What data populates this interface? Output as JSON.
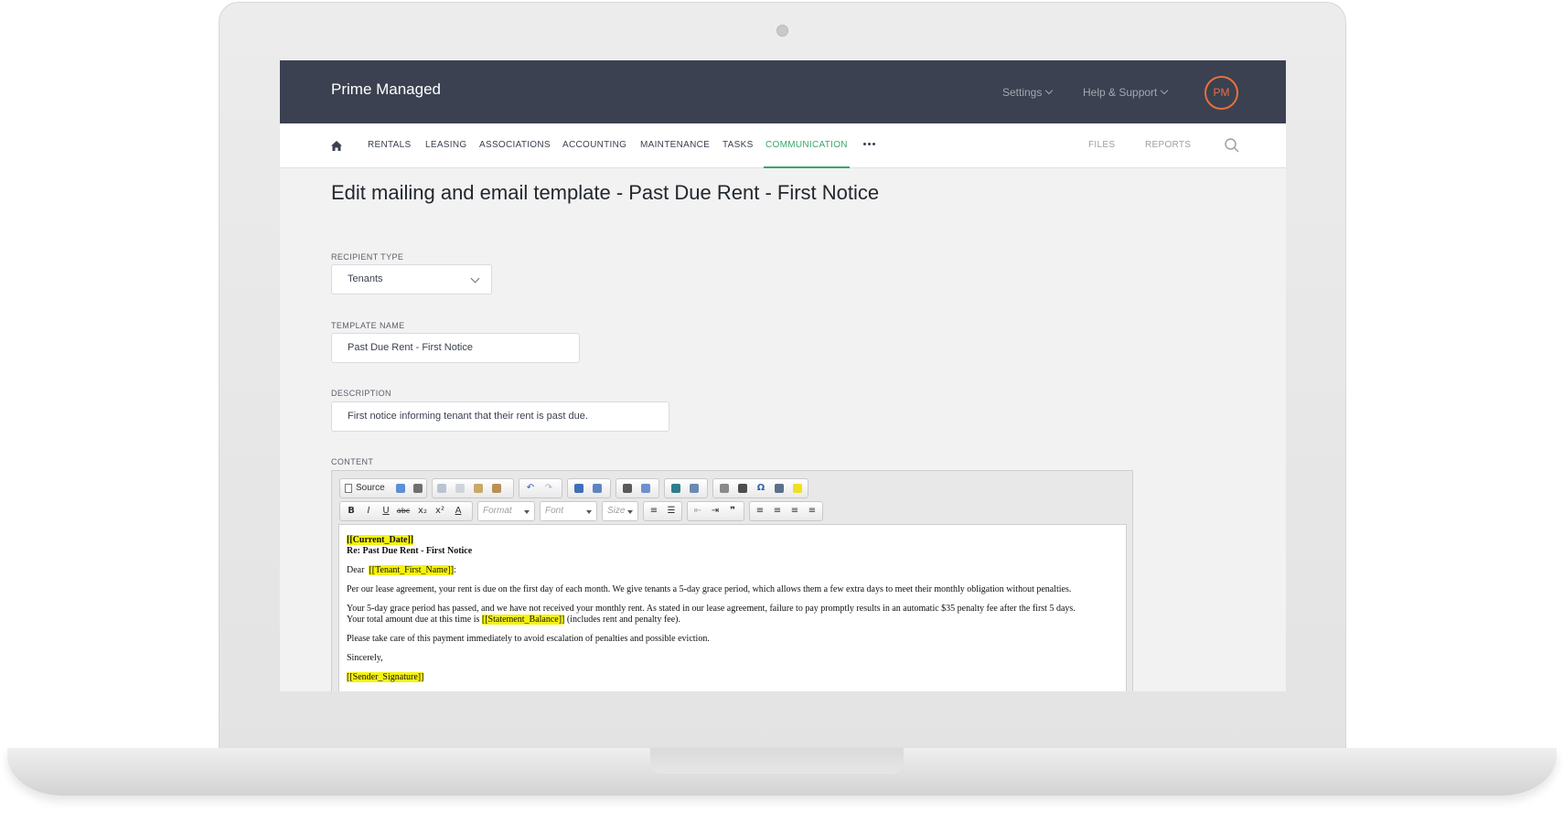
{
  "app": {
    "brand": "Prime Managed",
    "top_menu": {
      "settings": "Settings",
      "help": "Help & Support",
      "avatar_initials": "PM"
    }
  },
  "nav": {
    "items": [
      "RENTALS",
      "LEASING",
      "ASSOCIATIONS",
      "ACCOUNTING",
      "MAINTENANCE",
      "TASKS",
      "COMMUNICATION"
    ],
    "active": "COMMUNICATION",
    "right_items": [
      "FILES",
      "REPORTS"
    ]
  },
  "page": {
    "title": "Edit mailing and email template - Past Due Rent - First Notice"
  },
  "form": {
    "recipient_type": {
      "label": "RECIPIENT TYPE",
      "value": "Tenants"
    },
    "template_name": {
      "label": "TEMPLATE NAME",
      "value": "Past Due Rent - First Notice"
    },
    "description": {
      "label": "DESCRIPTION",
      "value": "First notice informing tenant that their rent is past due."
    },
    "content": {
      "label": "CONTENT"
    }
  },
  "editor": {
    "toolbar": {
      "source_label": "Source",
      "format_placeholder": "Format",
      "font_placeholder": "Font",
      "size_placeholder": "Size",
      "bold": "B",
      "italic": "I",
      "underline": "U",
      "strike": "abc",
      "subscript": "x₂",
      "superscript": "x²",
      "text_color": "A",
      "blockquote": "❞",
      "special_char": "Ω"
    },
    "body": {
      "date_token": "[[Current_Date]]",
      "subject": "Re: Past Due Rent - First Notice",
      "greeting_prefix": "Dear",
      "first_name_token": "[[Tenant_First_Name]]",
      "greeting_suffix": ":",
      "paragraph1": "Per our lease agreement, your rent is due on the first day of each month. We give tenants a 5-day grace period, which allows them a few extra days to meet their monthly obligation without penalties.",
      "paragraph2_line1": "Your 5-day grace period has passed, and we have not received your monthly rent. As stated in our lease agreement, failure to pay promptly results in an automatic $35 penalty fee after the first 5 days.",
      "paragraph2_prefix": "Your total amount due at this time is",
      "balance_token": "[[Statement_Balance]]",
      "paragraph2_suffix": "(includes rent and penalty fee).",
      "paragraph3": "Please take care of this payment immediately to avoid escalation of penalties and possible eviction.",
      "closing": "Sincerely,",
      "signature_token": "[[Sender_Signature]]"
    }
  },
  "colors": {
    "topbar": "#3b4150",
    "accent_green": "#39a66a",
    "avatar_orange": "#e8703e",
    "token_highlight": "#f6f20e"
  }
}
